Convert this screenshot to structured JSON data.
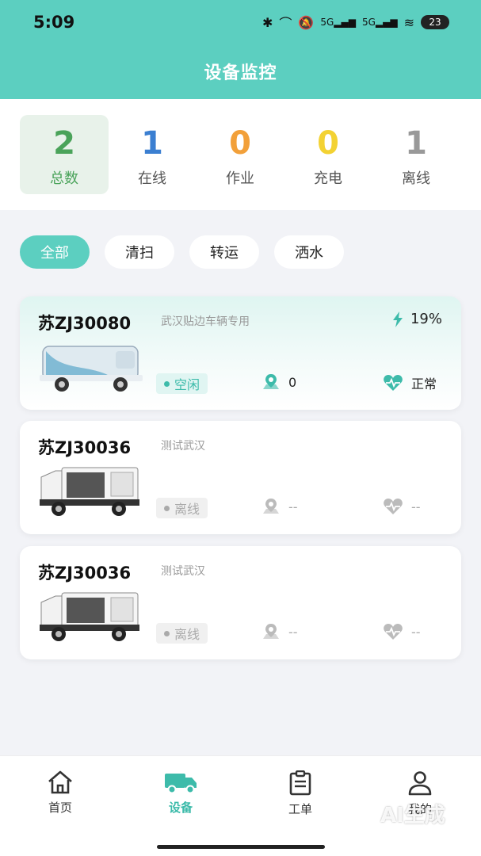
{
  "status_bar": {
    "time": "5:09",
    "battery": "23",
    "signal1": "5G",
    "signal2": "5G"
  },
  "header": {
    "title": "设备监控"
  },
  "stats": [
    {
      "value": "2",
      "label": "总数",
      "color": "#4aa35a"
    },
    {
      "value": "1",
      "label": "在线",
      "color": "#3b7fd1"
    },
    {
      "value": "0",
      "label": "作业",
      "color": "#f2a03a"
    },
    {
      "value": "0",
      "label": "充电",
      "color": "#f3d233"
    },
    {
      "value": "1",
      "label": "离线",
      "color": "#999999"
    }
  ],
  "filters": [
    "全部",
    "清扫",
    "转运",
    "洒水"
  ],
  "devices": [
    {
      "plate": "苏ZJ30080",
      "desc": "武汉贴边车辆专用",
      "battery": "19%",
      "state": "空闲",
      "tasks": "0",
      "health": "正常"
    },
    {
      "plate": "苏ZJ30036",
      "desc": "测试武汉",
      "state": "离线",
      "tasks": "--",
      "health": "--"
    },
    {
      "plate": "苏ZJ30036",
      "desc": "测试武汉",
      "state": "离线",
      "tasks": "--",
      "health": "--"
    }
  ],
  "nav": [
    "首页",
    "设备",
    "工单",
    "我的"
  ],
  "watermark": "AI生成",
  "colors": {
    "accent": "#5ccfc0",
    "accent_text": "#3dbbaa"
  }
}
